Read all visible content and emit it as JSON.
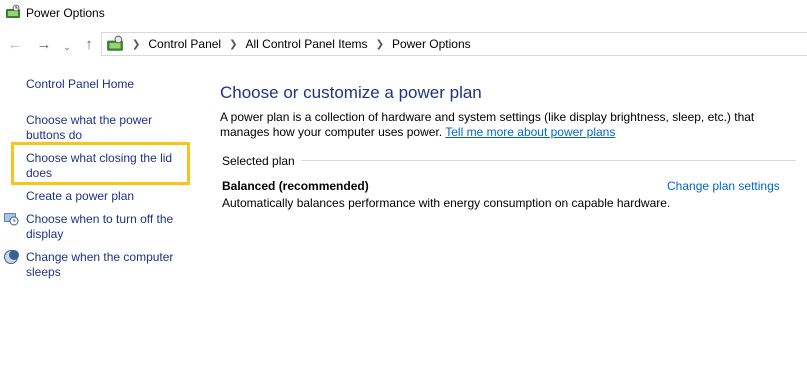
{
  "window": {
    "title": "Power Options",
    "icon": "power-options-icon"
  },
  "nav": {
    "back_icon": "arrow-left-icon",
    "forward_icon": "arrow-right-icon",
    "recent_icon": "chevron-down-icon",
    "up_icon": "arrow-up-icon",
    "breadcrumbs": [
      "Control Panel",
      "All Control Panel Items",
      "Power Options"
    ]
  },
  "sidebar": {
    "home": "Control Panel Home",
    "items": [
      {
        "label": "Choose what the power buttons do"
      },
      {
        "label": "Choose what closing the lid does",
        "highlighted": true
      },
      {
        "label": "Create a power plan"
      },
      {
        "label": "Choose when to turn off the display",
        "icon": "display-clock-icon"
      },
      {
        "label": "Change when the computer sleeps",
        "icon": "moon-icon"
      }
    ],
    "highlight_color": "#f5c518"
  },
  "main": {
    "heading": "Choose or customize a power plan",
    "description": "A power plan is a collection of hardware and system settings (like display brightness, sleep, etc.) that manages how your computer uses power.",
    "learn_more": "Tell me more about power plans",
    "section_label": "Selected plan",
    "plan_name": "Balanced (recommended)",
    "plan_settings_link": "Change plan settings",
    "plan_description": "Automatically balances performance with energy consumption on capable hardware."
  },
  "colors": {
    "link": "#1e3287",
    "hyperlink": "#0066cc",
    "heading": "#1e3287"
  }
}
